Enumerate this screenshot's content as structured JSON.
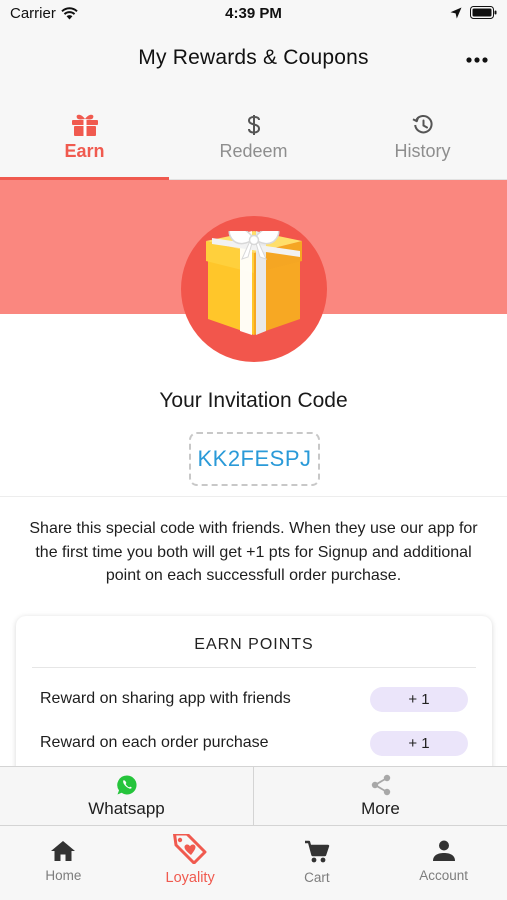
{
  "status_bar": {
    "carrier": "Carrier",
    "time": "4:39 PM"
  },
  "header": {
    "title": "My Rewards & Coupons",
    "more_icon": "more-horizontal-icon"
  },
  "tabs": [
    {
      "label": "Earn",
      "icon": "gift-icon",
      "active": true
    },
    {
      "label": "Redeem",
      "icon": "dollar-icon",
      "active": false
    },
    {
      "label": "History",
      "icon": "history-icon",
      "active": false
    }
  ],
  "invitation": {
    "title": "Your Invitation Code",
    "code": "KK2FESPJ",
    "description": "Share this special code with friends. When they use our app for the first time you both will get +1 pts for Signup and additional point on each successfull order purchase."
  },
  "earn_points": {
    "title": "EARN POINTS",
    "rows": [
      {
        "label": "Reward on sharing app with friends",
        "value": "+ 1"
      },
      {
        "label": "Reward on each order purchase",
        "value": "+ 1"
      }
    ]
  },
  "share_buttons": [
    {
      "label": "Whatsapp",
      "icon": "whatsapp-icon"
    },
    {
      "label": "More",
      "icon": "share-icon"
    }
  ],
  "tab_bar": [
    {
      "label": "Home",
      "icon": "home-icon",
      "active": false
    },
    {
      "label": "Loyality",
      "icon": "loyalty-tag-icon",
      "active": true
    },
    {
      "label": "Cart",
      "icon": "cart-icon",
      "active": false
    },
    {
      "label": "Account",
      "icon": "account-icon",
      "active": false
    }
  ],
  "colors": {
    "accent": "#f05a4f",
    "banner": "#fa877f",
    "gift_circle": "#f2564c",
    "code_text": "#2a9ad8",
    "pill": "#ebe5fa",
    "whatsapp": "#25c43b"
  }
}
